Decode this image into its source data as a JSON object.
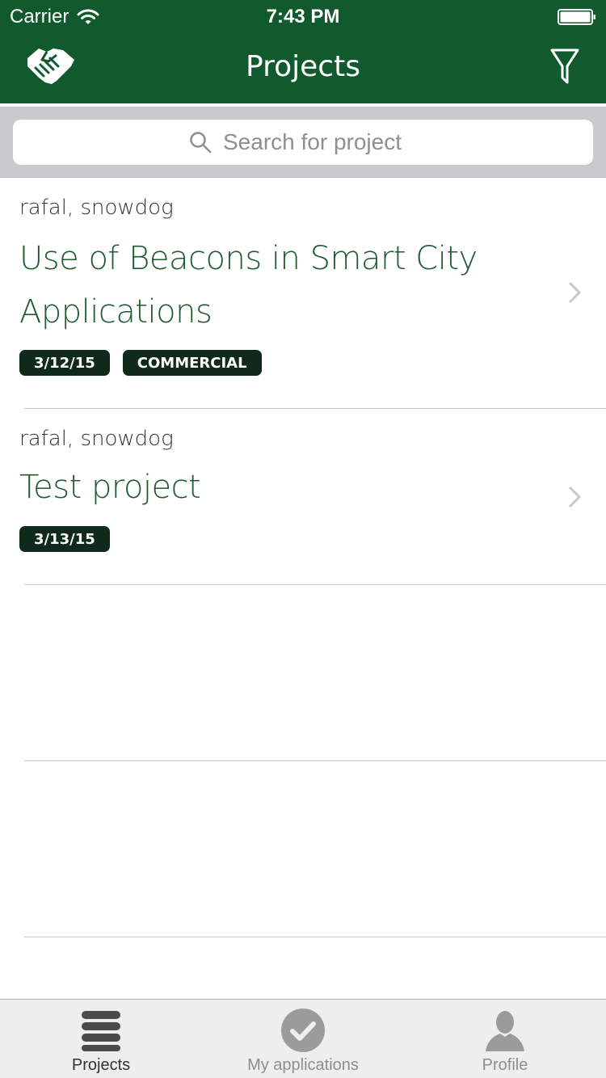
{
  "status_bar": {
    "carrier": "Carrier",
    "time": "7:43 PM"
  },
  "nav": {
    "title": "Projects"
  },
  "search": {
    "placeholder": "Search for project"
  },
  "projects": [
    {
      "authors": "rafal, snowdog",
      "title": "Use of Beacons in Smart City Applications",
      "tags": [
        "3/12/15",
        "COMMERCIAL"
      ]
    },
    {
      "authors": "rafal, snowdog",
      "title": "Test project",
      "tags": [
        "3/13/15"
      ]
    }
  ],
  "tabs": [
    {
      "label": "Projects",
      "icon": "list-icon",
      "active": true
    },
    {
      "label": "My applications",
      "icon": "checkmark-icon",
      "active": false
    },
    {
      "label": "Profile",
      "icon": "person-icon",
      "active": false
    }
  ],
  "colors": {
    "brand_green": "#105a2e",
    "title_green": "#1f5a30",
    "tag_bg": "#0f2a1c"
  }
}
